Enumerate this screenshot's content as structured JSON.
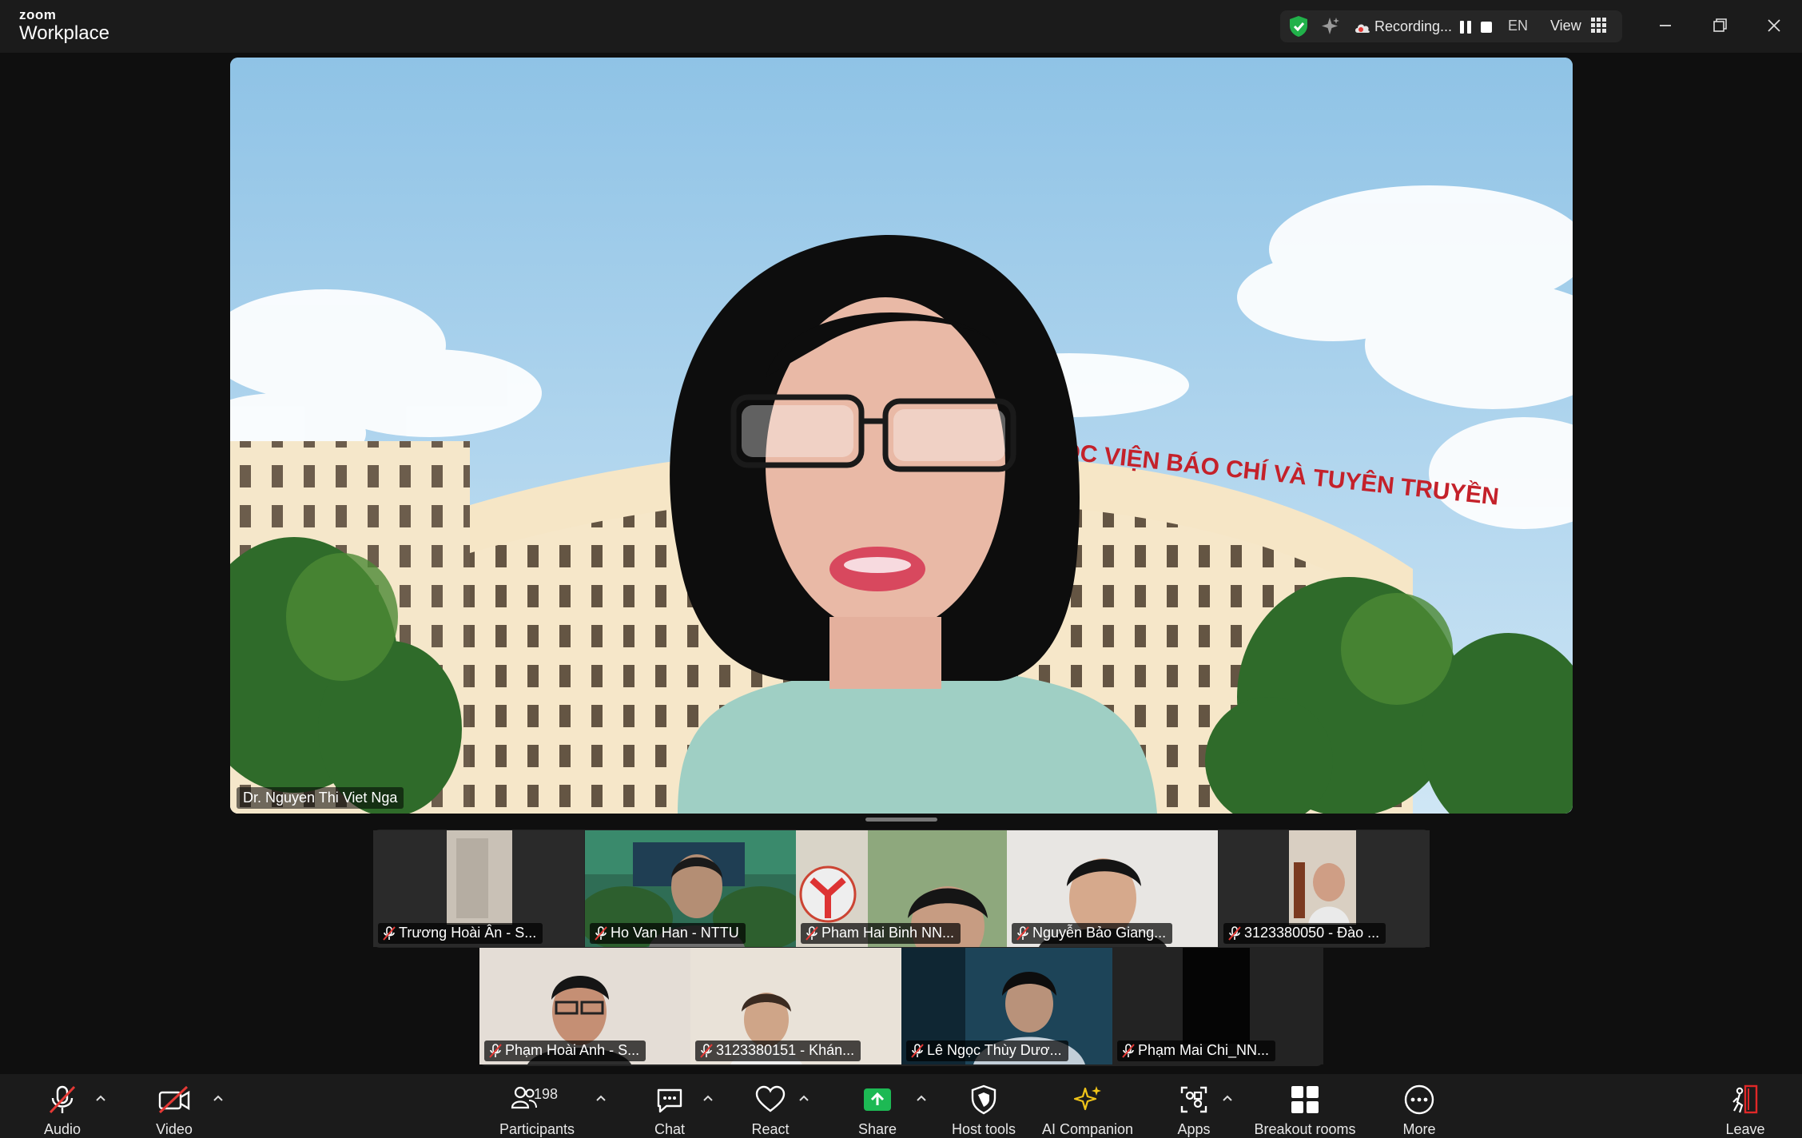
{
  "app": {
    "brand_small": "zoom",
    "brand_large": "Workplace"
  },
  "status": {
    "recording_label": "Recording...",
    "language": "EN",
    "view_label": "View"
  },
  "speaker": {
    "name": "Dr. Nguyen Thi Viet Nga"
  },
  "backdrop": {
    "sign_text": "HỌC VIỆN BÁO CHÍ VÀ TUYÊN TRUYỀN"
  },
  "gallery": {
    "row1": [
      {
        "name": "Trương Hoài Ân - S...",
        "muted": true
      },
      {
        "name": "Ho Van Han - NTTU",
        "muted": true
      },
      {
        "name": "Pham Hai Binh NN...",
        "muted": true
      },
      {
        "name": "Nguyễn Bảo Giang...",
        "muted": true
      },
      {
        "name": "3123380050 - Đào ...",
        "muted": true
      }
    ],
    "row2": [
      {
        "name": "Phạm Hoài Anh - S...",
        "muted": true
      },
      {
        "name": "3123380151 - Khán...",
        "muted": true
      },
      {
        "name": "Lê Ngọc Thùy Dươ...",
        "muted": true
      },
      {
        "name": "Phạm Mai Chi_NN...",
        "muted": true
      }
    ]
  },
  "toolbar": {
    "audio": "Audio",
    "video": "Video",
    "participants": "Participants",
    "participants_count": "198",
    "chat": "Chat",
    "react": "React",
    "share": "Share",
    "host_tools": "Host tools",
    "ai_companion": "AI Companion",
    "apps": "Apps",
    "breakout_rooms": "Breakout rooms",
    "more": "More",
    "leave": "Leave"
  },
  "colors": {
    "share_green": "#1db954",
    "muted_red": "#e53935",
    "leave_red": "#e02828",
    "toolbar_bg": "#1b1b1b"
  }
}
